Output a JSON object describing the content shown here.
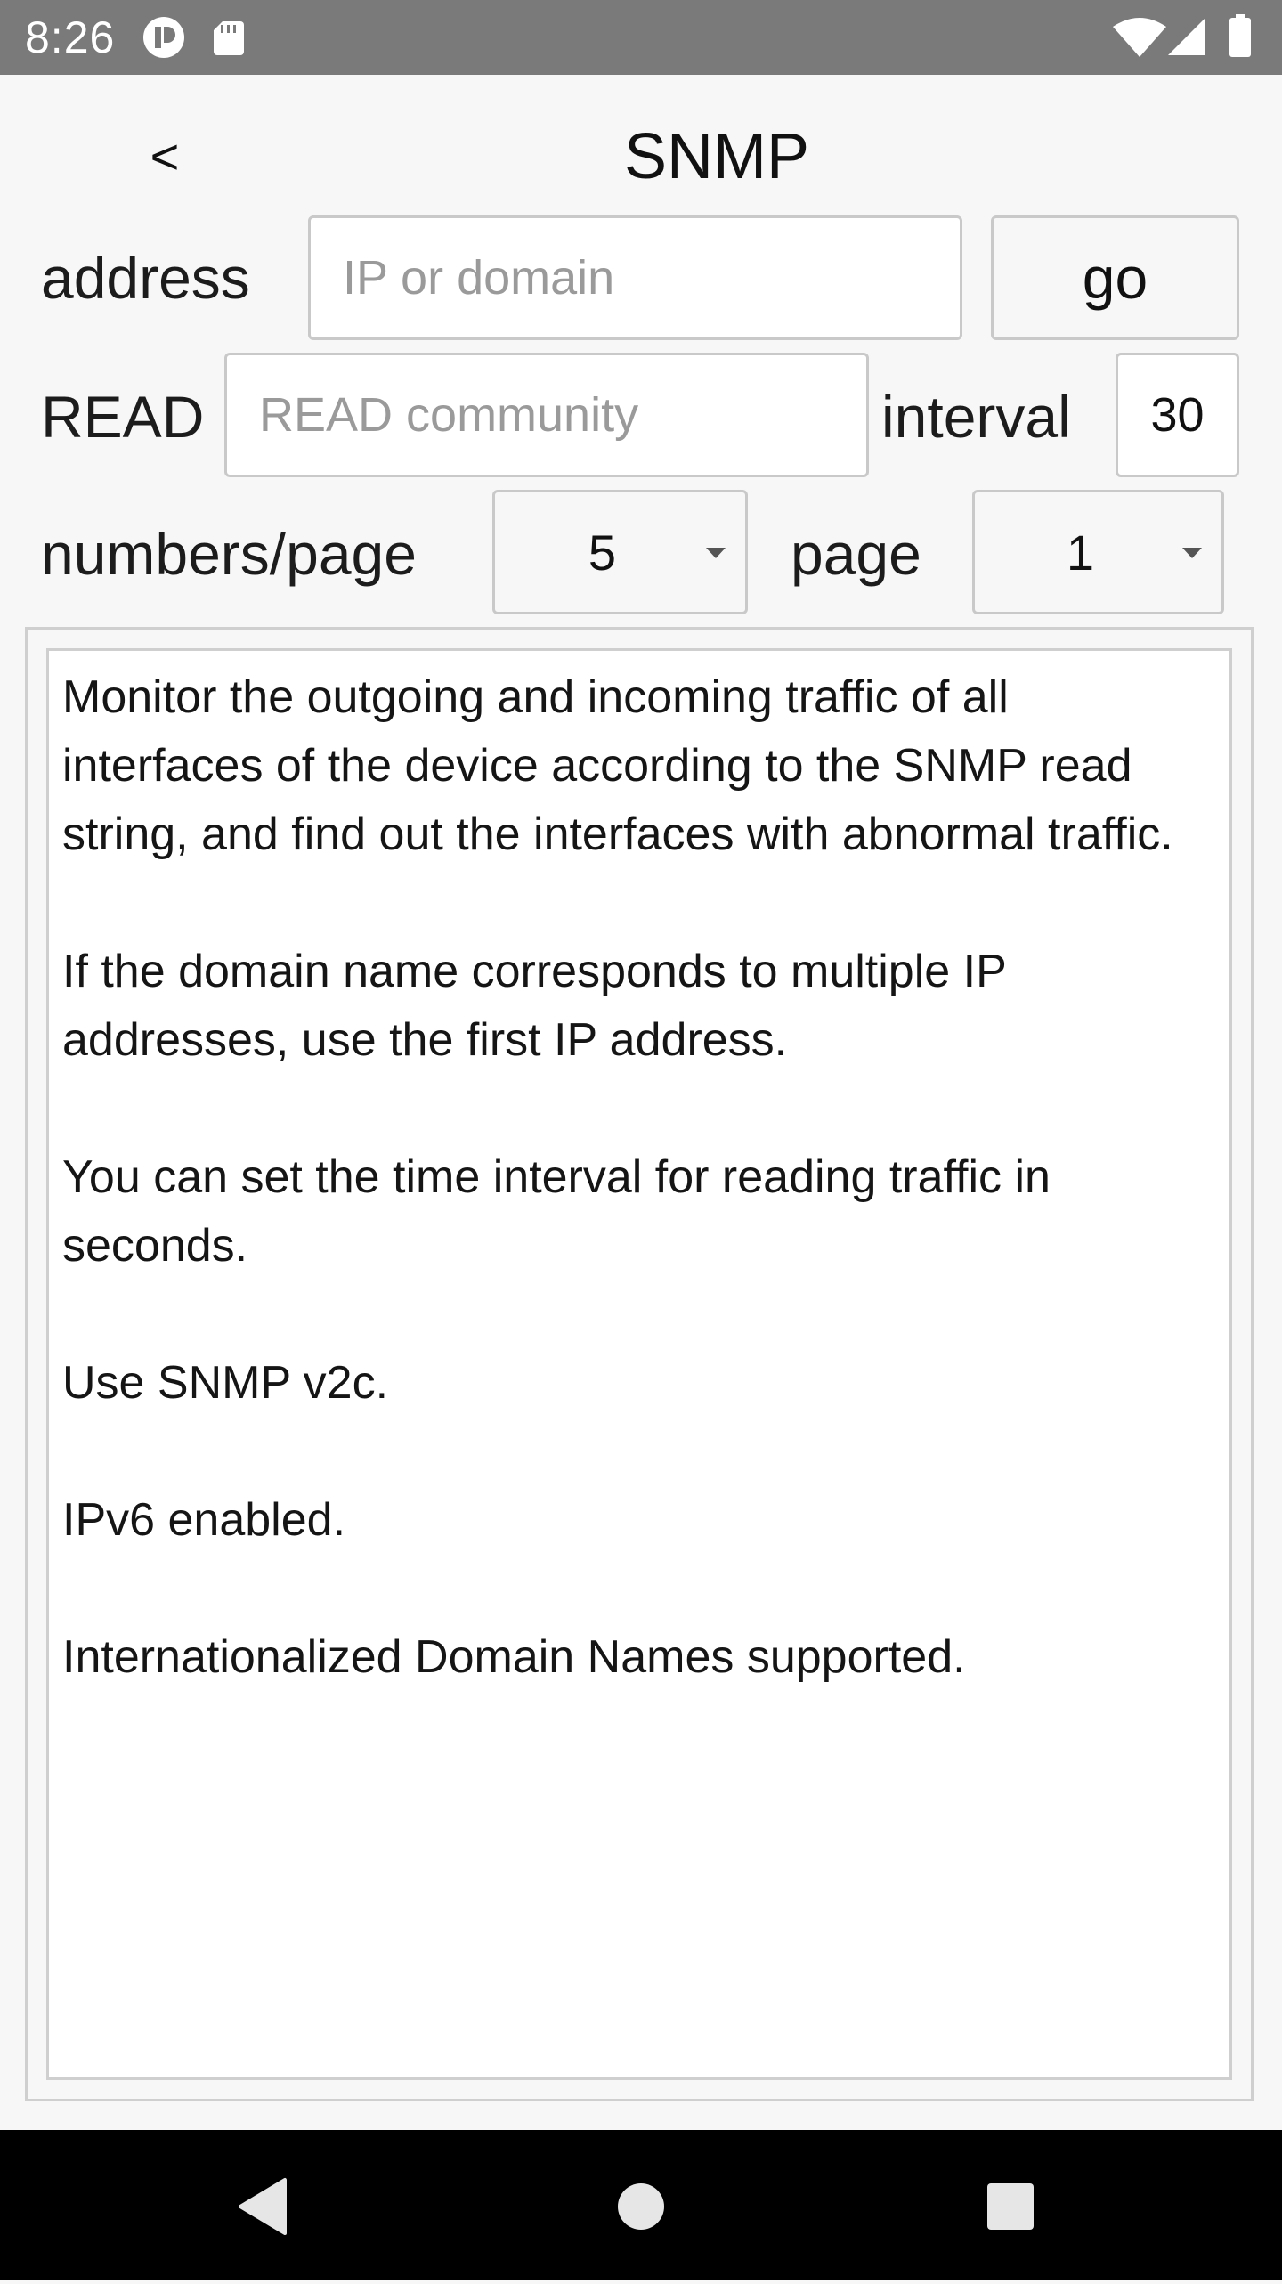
{
  "status_bar": {
    "time": "8:26",
    "left_icons": [
      "app-notification-icon",
      "sd-card-icon"
    ],
    "right_icons": [
      "wifi-icon",
      "cellular-signal-icon",
      "battery-icon"
    ]
  },
  "header": {
    "back_label": "<",
    "title": "SNMP"
  },
  "form": {
    "address_label": "address",
    "address_value": "",
    "address_placeholder": "IP or domain",
    "go_label": "go",
    "read_label": "READ",
    "read_value": "",
    "read_placeholder": "READ community",
    "interval_label": "interval",
    "interval_value": "30",
    "numbers_per_page_label": "numbers/page",
    "numbers_per_page_value": "5",
    "page_label": "page",
    "page_value": "1"
  },
  "info": {
    "paragraphs": [
      "Monitor the outgoing and incoming traffic of all interfaces of the device according to the SNMP read string, and find out the interfaces with abnormal traffic.",
      "If the domain name corresponds to multiple IP addresses, use the first IP address.",
      "You can set the time interval for reading traffic in seconds.",
      "Use SNMP v2c.",
      "IPv6 enabled.",
      "Internationalized Domain Names supported."
    ]
  },
  "nav_bar": {
    "buttons": [
      "back-icon",
      "home-icon",
      "recents-icon"
    ]
  }
}
